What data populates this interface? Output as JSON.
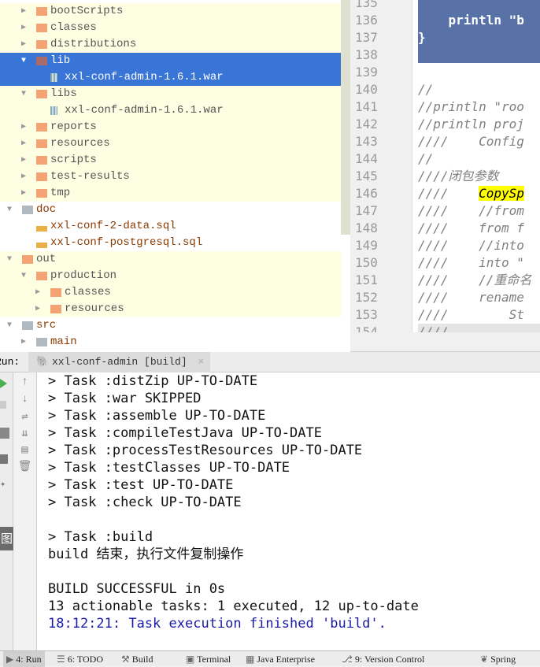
{
  "tree": [
    {
      "label": "bootScripts",
      "level": 1,
      "arrow": "right",
      "icon": "folder",
      "style": "y"
    },
    {
      "label": "classes",
      "level": 1,
      "arrow": "right",
      "icon": "folder",
      "style": "y"
    },
    {
      "label": "distributions",
      "level": 1,
      "arrow": "right",
      "icon": "folder",
      "style": "y"
    },
    {
      "label": "lib",
      "level": 1,
      "arrow": "down",
      "icon": "folder-dark",
      "style": "sel"
    },
    {
      "label": "xxl-conf-admin-1.6.1.war",
      "level": 2,
      "arrow": "",
      "icon": "war",
      "style": "sel"
    },
    {
      "label": "libs",
      "level": 1,
      "arrow": "down",
      "icon": "folder",
      "style": "y"
    },
    {
      "label": "xxl-conf-admin-1.6.1.war",
      "level": 2,
      "arrow": "",
      "icon": "war",
      "style": "y"
    },
    {
      "label": "reports",
      "level": 1,
      "arrow": "right",
      "icon": "folder",
      "style": "y"
    },
    {
      "label": "resources",
      "level": 1,
      "arrow": "right",
      "icon": "folder",
      "style": "y"
    },
    {
      "label": "scripts",
      "level": 1,
      "arrow": "right",
      "icon": "folder",
      "style": "y"
    },
    {
      "label": "test-results",
      "level": 1,
      "arrow": "right",
      "icon": "folder",
      "style": "y"
    },
    {
      "label": "tmp",
      "level": 1,
      "arrow": "right",
      "icon": "folder",
      "style": "y"
    },
    {
      "label": "doc",
      "level": 0,
      "arrow": "down",
      "icon": "folder-gray",
      "style": "brown"
    },
    {
      "label": "xxl-conf-2-data.sql",
      "level": 1,
      "arrow": "",
      "icon": "sql",
      "style": "brown"
    },
    {
      "label": "xxl-conf-postgresql.sql",
      "level": 1,
      "arrow": "",
      "icon": "sql",
      "style": "brown"
    },
    {
      "label": "out",
      "level": 0,
      "arrow": "down",
      "icon": "folder",
      "style": "y"
    },
    {
      "label": "production",
      "level": 1,
      "arrow": "down",
      "icon": "folder",
      "style": "y"
    },
    {
      "label": "classes",
      "level": 2,
      "arrow": "right",
      "icon": "folder",
      "style": "y"
    },
    {
      "label": "resources",
      "level": 2,
      "arrow": "right",
      "icon": "folder",
      "style": "y"
    },
    {
      "label": "src",
      "level": 0,
      "arrow": "down",
      "icon": "folder-gray",
      "style": "brown"
    },
    {
      "label": "main",
      "level": 1,
      "arrow": "right",
      "icon": "folder-module",
      "style": "brown"
    }
  ],
  "editor": {
    "lines": [
      {
        "n": "135",
        "code": ""
      },
      {
        "n": "136",
        "code": "    println \"b"
      },
      {
        "n": "137",
        "code": "}"
      },
      {
        "n": "138",
        "code": ""
      },
      {
        "n": "139",
        "code": ""
      },
      {
        "n": "140",
        "code": "//"
      },
      {
        "n": "141",
        "code": "//println \"roo"
      },
      {
        "n": "142",
        "code": "//println proj"
      },
      {
        "n": "143",
        "code": "////    Config"
      },
      {
        "n": "144",
        "code": "//"
      },
      {
        "n": "145",
        "code": "////闭包参数"
      },
      {
        "n": "146",
        "code": "////    CopySp"
      },
      {
        "n": "147",
        "code": "////    //from"
      },
      {
        "n": "148",
        "code": "////    from f"
      },
      {
        "n": "149",
        "code": "////    //into"
      },
      {
        "n": "150",
        "code": "////    into \""
      },
      {
        "n": "151",
        "code": "////    //重命名"
      },
      {
        "n": "152",
        "code": "////    rename"
      },
      {
        "n": "153",
        "code": "////        St"
      },
      {
        "n": "154",
        "code": "////"
      }
    ],
    "highlight_color": "#ffff00"
  },
  "run": {
    "label": "Run:",
    "tab": "xxl-conf-admin [build]",
    "close": "×"
  },
  "console": [
    {
      "text": "> Task :distZip UP-TO-DATE"
    },
    {
      "text": "> Task :war SKIPPED"
    },
    {
      "text": "> Task :assemble UP-TO-DATE"
    },
    {
      "text": "> Task :compileTestJava UP-TO-DATE"
    },
    {
      "text": "> Task :processTestResources UP-TO-DATE"
    },
    {
      "text": "> Task :testClasses UP-TO-DATE"
    },
    {
      "text": "> Task :test UP-TO-DATE"
    },
    {
      "text": "> Task :check UP-TO-DATE"
    },
    {
      "text": ""
    },
    {
      "text": "> Task :build"
    },
    {
      "text": "build 结束，执行文件复制操作"
    },
    {
      "text": ""
    },
    {
      "text": "BUILD SUCCESSFUL in 0s"
    },
    {
      "text": "13 actionable tasks: 1 executed, 12 up-to-date"
    },
    {
      "text": "18:12:21: Task execution finished 'build'.",
      "blue": true
    }
  ],
  "side_badge": "图",
  "status": [
    {
      "label": "4: Run"
    },
    {
      "label": "6: TODO"
    },
    {
      "label": "Build"
    },
    {
      "label": "Terminal"
    },
    {
      "label": "Java Enterprise"
    },
    {
      "label": "9: Version Control"
    },
    {
      "label": "Spring"
    }
  ],
  "colors": {
    "selection": "#3875d7",
    "tree_yellow": "#fefee3",
    "editor_block": "#5872a8"
  }
}
